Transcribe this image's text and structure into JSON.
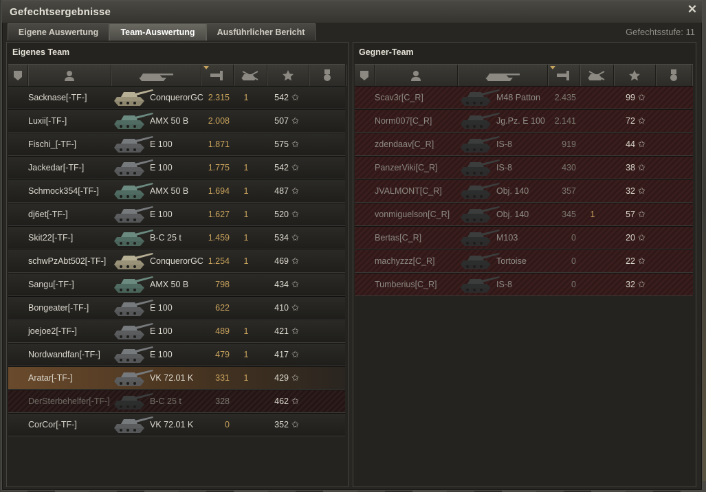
{
  "window": {
    "title": "Gefechtsergebnisse",
    "close_icon": "close-icon",
    "battle_tier": "Gefechtsstufe: 11"
  },
  "tabs": [
    {
      "label": "Eigene Auswertung",
      "active": false
    },
    {
      "label": "Team-Auswertung",
      "active": true
    },
    {
      "label": "Ausführlicher Bericht",
      "active": false
    }
  ],
  "columns_icons": [
    "squad-icon",
    "player-icon",
    "tank-icon",
    "damage-icon",
    "kills-icon",
    "xp-star-icon",
    "medal-icon"
  ],
  "colors": {
    "damage": "#c9a35c",
    "own_row": "#2b2a26",
    "enemy_row": "#3a1d1d",
    "self_row": "#6a4a2c"
  },
  "own_team": {
    "title": "Eigenes Team",
    "players": [
      {
        "name": "Sacknase[-TF-]",
        "vehicle": "ConquerorGC",
        "damage": "2.315",
        "kills": "1",
        "xp": "542",
        "style": "own",
        "tank": "light"
      },
      {
        "name": "Luxii[-TF-]",
        "vehicle": "AMX 50 B",
        "damage": "2.008",
        "kills": "",
        "xp": "507",
        "style": "own",
        "tank": "green"
      },
      {
        "name": "Fischi_[-TF-]",
        "vehicle": "E 100",
        "damage": "1.871",
        "kills": "",
        "xp": "575",
        "style": "own",
        "tank": "grey"
      },
      {
        "name": "Jackedar[-TF-]",
        "vehicle": "E 100",
        "damage": "1.775",
        "kills": "1",
        "xp": "542",
        "style": "own",
        "tank": "grey"
      },
      {
        "name": "Schmock354[-TF-]",
        "vehicle": "AMX 50 B",
        "damage": "1.694",
        "kills": "1",
        "xp": "487",
        "style": "own",
        "tank": "green"
      },
      {
        "name": "dj6et[-TF-]",
        "vehicle": "E 100",
        "damage": "1.627",
        "kills": "1",
        "xp": "520",
        "style": "own",
        "tank": "grey"
      },
      {
        "name": "Skit22[-TF-]",
        "vehicle": "B-C 25 t",
        "damage": "1.459",
        "kills": "1",
        "xp": "534",
        "style": "own",
        "tank": "green"
      },
      {
        "name": "schwPzAbt502[-TF-]",
        "vehicle": "ConquerorGC",
        "damage": "1.254",
        "kills": "1",
        "xp": "469",
        "style": "own",
        "tank": "light"
      },
      {
        "name": "Sangu[-TF-]",
        "vehicle": "AMX 50 B",
        "damage": "798",
        "kills": "",
        "xp": "434",
        "style": "own",
        "tank": "green"
      },
      {
        "name": "Bongeater[-TF-]",
        "vehicle": "E 100",
        "damage": "622",
        "kills": "",
        "xp": "410",
        "style": "own",
        "tank": "grey"
      },
      {
        "name": "joejoe2[-TF-]",
        "vehicle": "E 100",
        "damage": "489",
        "kills": "1",
        "xp": "421",
        "style": "own",
        "tank": "grey"
      },
      {
        "name": "Nordwandfan[-TF-]",
        "vehicle": "E 100",
        "damage": "479",
        "kills": "1",
        "xp": "417",
        "style": "own",
        "tank": "grey"
      },
      {
        "name": "Aratar[-TF-]",
        "vehicle": "VK 72.01 K",
        "damage": "331",
        "kills": "1",
        "xp": "429",
        "style": "me",
        "tank": "grey"
      },
      {
        "name": "DerSterbehelfer[-TF-]",
        "vehicle": "B-C 25 t",
        "damage": "328",
        "kills": "",
        "xp": "462",
        "style": "dead",
        "tank": "dark"
      },
      {
        "name": "CorCor[-TF-]",
        "vehicle": "VK 72.01 K",
        "damage": "0",
        "kills": "",
        "xp": "352",
        "style": "own",
        "tank": "grey"
      }
    ]
  },
  "enemy_team": {
    "title": "Gegner-Team",
    "players": [
      {
        "name": "Scav3r[C_R]",
        "vehicle": "M48 Patton",
        "damage": "2.435",
        "kills": "",
        "xp": "99",
        "style": "enemy",
        "tank": "dark"
      },
      {
        "name": "Norm007[C_R]",
        "vehicle": "Jg.Pz. E 100",
        "damage": "2.141",
        "kills": "",
        "xp": "72",
        "style": "enemy",
        "tank": "dark"
      },
      {
        "name": "zdendaav[C_R]",
        "vehicle": "IS-8",
        "damage": "919",
        "kills": "",
        "xp": "44",
        "style": "enemy",
        "tank": "dark"
      },
      {
        "name": "PanzerViki[C_R]",
        "vehicle": "IS-8",
        "damage": "430",
        "kills": "",
        "xp": "38",
        "style": "enemy",
        "tank": "dark"
      },
      {
        "name": "JVALMONT[C_R]",
        "vehicle": "Obj. 140",
        "damage": "357",
        "kills": "",
        "xp": "32",
        "style": "enemy",
        "tank": "dark"
      },
      {
        "name": "vonmiguelson[C_R]",
        "vehicle": "Obj. 140",
        "damage": "345",
        "kills": "1",
        "xp": "57",
        "style": "enemy",
        "tank": "dark"
      },
      {
        "name": "Bertas[C_R]",
        "vehicle": "M103",
        "damage": "0",
        "kills": "",
        "xp": "20",
        "style": "enemy",
        "tank": "dark"
      },
      {
        "name": "machyzzz[C_R]",
        "vehicle": "Tortoise",
        "damage": "0",
        "kills": "",
        "xp": "22",
        "style": "enemy",
        "tank": "dark"
      },
      {
        "name": "Tumberius[C_R]",
        "vehicle": "IS-8",
        "damage": "0",
        "kills": "",
        "xp": "32",
        "style": "enemy",
        "tank": "dark"
      }
    ]
  }
}
